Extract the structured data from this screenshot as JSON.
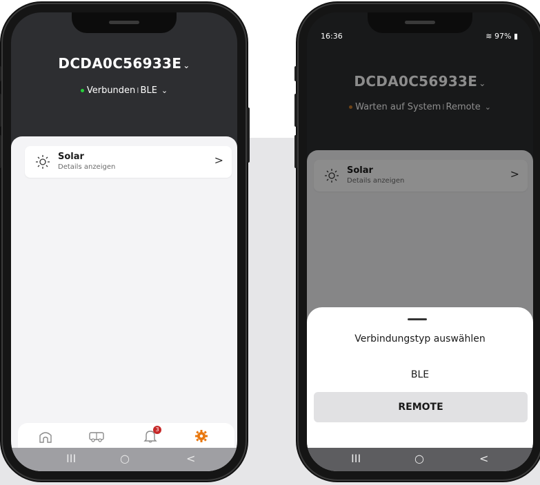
{
  "left_phone": {
    "device_name": "DCDA0C56933E",
    "chevron": "⌄",
    "status_dot_color": "#27d13c",
    "status_text": "Verbunden",
    "separator": "I",
    "connection_type": "BLE",
    "cards": [
      {
        "icon": "sun-icon",
        "title": "Solar",
        "subtitle": "Details anzeigen",
        "chevron": ">"
      }
    ],
    "tabs": [
      {
        "icon": "home-icon"
      },
      {
        "icon": "vehicle-icon"
      },
      {
        "icon": "bell-icon",
        "badge": "3"
      },
      {
        "icon": "gear-icon",
        "active_color": "#e9780f"
      }
    ],
    "navbar": {
      "recents": "III",
      "home": "○",
      "back": "<"
    }
  },
  "right_phone": {
    "status_time": "16:36",
    "status_battery": "97%",
    "device_name": "DCDA0C56933E",
    "chevron": "⌄",
    "status_dot_color": "#c87a28",
    "status_text": "Warten auf System",
    "separator": "I",
    "connection_type": "Remote",
    "cards": [
      {
        "icon": "sun-icon",
        "title": "Solar",
        "subtitle": "Details anzeigen",
        "chevron": ">"
      }
    ],
    "sheet": {
      "title": "Verbindungstyp auswählen",
      "options": [
        "BLE",
        "REMOTE"
      ]
    },
    "navbar": {
      "recents": "III",
      "home": "○",
      "back": "<"
    }
  }
}
